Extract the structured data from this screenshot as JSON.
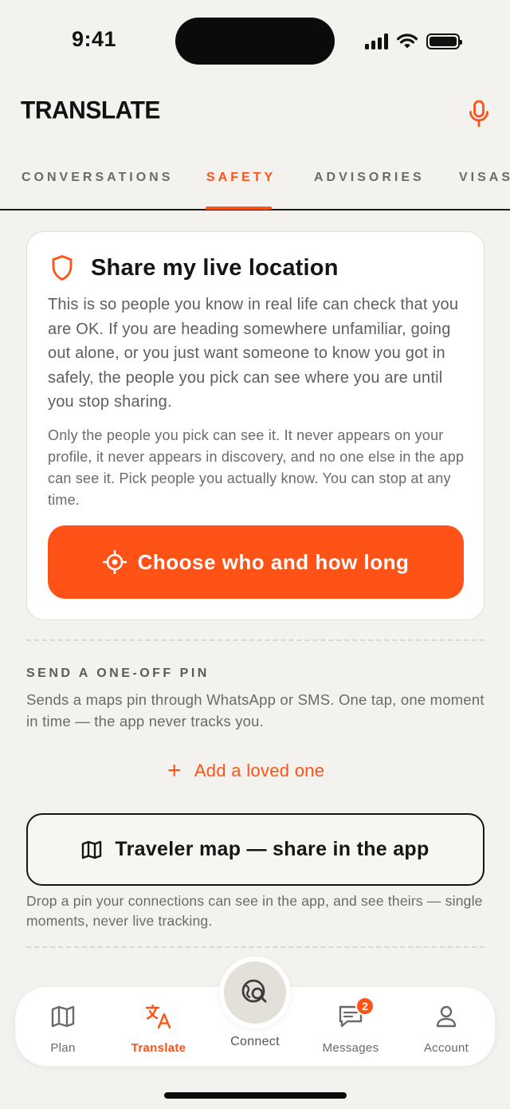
{
  "status_bar": {
    "time": "9:41"
  },
  "header": {
    "title": "TRANSLATE"
  },
  "tabs": [
    {
      "label": "CONVERSATIONS",
      "active": false
    },
    {
      "label": "SAFETY",
      "active": true
    },
    {
      "label": "ADVISORIES",
      "active": false
    },
    {
      "label": "VISAS",
      "active": false
    }
  ],
  "live_location_card": {
    "title": "Share my live location",
    "body": "This is so people you know in real life can check that you are OK. If you are heading somewhere unfamiliar, going out alone, or you just want someone to know you got in safely, the people you pick can see where you are until you stop sharing.",
    "note": "Only the people you pick can see it. It never appears on your profile, it never appears in discovery, and no one else in the app can see it. Pick people you actually know. You can stop at any time.",
    "button_label": "Choose who and how long"
  },
  "one_off_pin": {
    "label": "SEND A ONE-OFF PIN",
    "description": "Sends a maps pin through WhatsApp or SMS. One tap, one moment in time — the app never tracks you.",
    "add_label": "Add a loved one"
  },
  "traveler_map": {
    "button_label": "Traveler map — share in the app",
    "description": "Drop a pin your connections can see in the app, and see theirs — single moments, never live tracking."
  },
  "bottom_nav": {
    "items": [
      {
        "label": "Plan",
        "icon": "map-icon",
        "active": false
      },
      {
        "label": "Translate",
        "icon": "translate-icon",
        "active": true
      },
      {
        "label": "Connect",
        "icon": "globe-search-icon",
        "active": false
      },
      {
        "label": "Messages",
        "icon": "chat-icon",
        "active": false,
        "badge": "2"
      },
      {
        "label": "Account",
        "icon": "user-icon",
        "active": false
      }
    ]
  },
  "colors": {
    "accent": "#ff5216",
    "background": "#f3f2ee",
    "text": "#1b1b1b"
  }
}
